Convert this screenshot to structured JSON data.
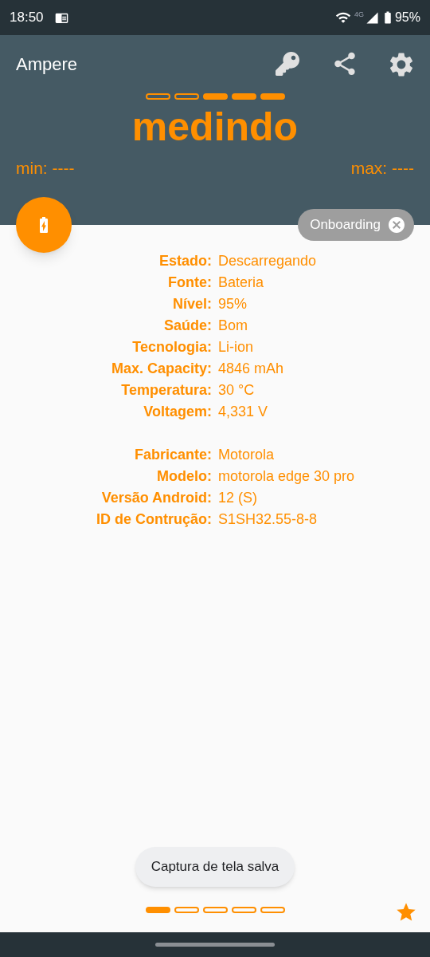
{
  "status_bar": {
    "time": "18:50",
    "network": "4G",
    "battery": "95%"
  },
  "app_bar": {
    "title": "Ampere"
  },
  "meter": {
    "segments": [
      {
        "filled": false
      },
      {
        "filled": false
      },
      {
        "filled": true
      },
      {
        "filled": true
      },
      {
        "filled": true
      }
    ]
  },
  "reading": "medindo",
  "min": "min: ----",
  "max": "max: ----",
  "chip": {
    "label": "Onboarding"
  },
  "info_groups": [
    [
      {
        "label": "Estado:",
        "value": "Descarregando"
      },
      {
        "label": "Fonte:",
        "value": "Bateria"
      },
      {
        "label": "Nível:",
        "value": "95%"
      },
      {
        "label": "Saúde:",
        "value": "Bom"
      },
      {
        "label": "Tecnologia:",
        "value": "Li-ion"
      },
      {
        "label": "Max. Capacity:",
        "value": "4846 mAh"
      },
      {
        "label": "Temperatura:",
        "value": "30 °C"
      },
      {
        "label": "Voltagem:",
        "value": "4,331 V"
      }
    ],
    [
      {
        "label": "Fabricante:",
        "value": "Motorola"
      },
      {
        "label": "Modelo:",
        "value": "motorola edge 30 pro"
      },
      {
        "label": "Versão Android:",
        "value": "12 (S)"
      },
      {
        "label": "ID de Contrução:",
        "value": "S1SH32.55-8-8"
      }
    ]
  ],
  "toast": "Captura de tela salva",
  "pages": [
    {
      "selected": true
    },
    {
      "selected": false
    },
    {
      "selected": false
    },
    {
      "selected": false
    },
    {
      "selected": false
    }
  ]
}
